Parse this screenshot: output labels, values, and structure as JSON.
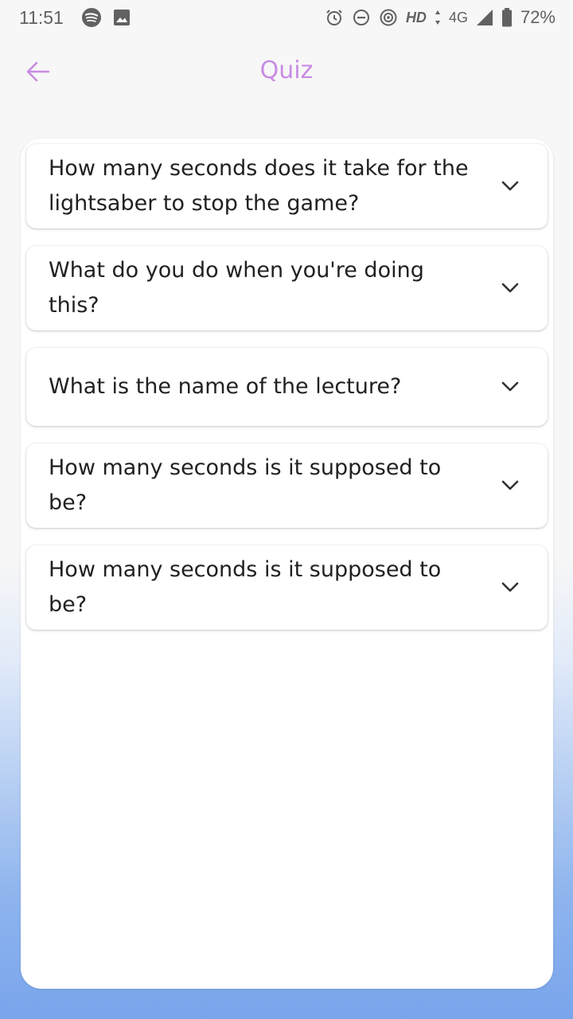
{
  "status_bar": {
    "time": "11:51",
    "left_icons": [
      "spotify-icon",
      "image-icon"
    ],
    "right_icons": [
      "alarm-icon",
      "do-not-disturb-icon",
      "hotspot-icon",
      "signal-icon",
      "battery-icon"
    ],
    "hd": "HD",
    "network": "4G",
    "battery": "72%"
  },
  "header": {
    "title": "Quiz",
    "back_icon": "back-arrow-icon"
  },
  "questions": [
    {
      "text": "How many seconds does it take for the lightsaber to stop the game?"
    },
    {
      "text": "What do you do when you're doing this?"
    },
    {
      "text": "What is the name of the lecture?"
    },
    {
      "text": "How many seconds is it supposed to be?"
    },
    {
      "text": "How many seconds is it supposed to be?"
    }
  ],
  "colors": {
    "accent": "#c98ce3",
    "text": "#212121",
    "background_gradient_bottom": "#79a5ec"
  }
}
